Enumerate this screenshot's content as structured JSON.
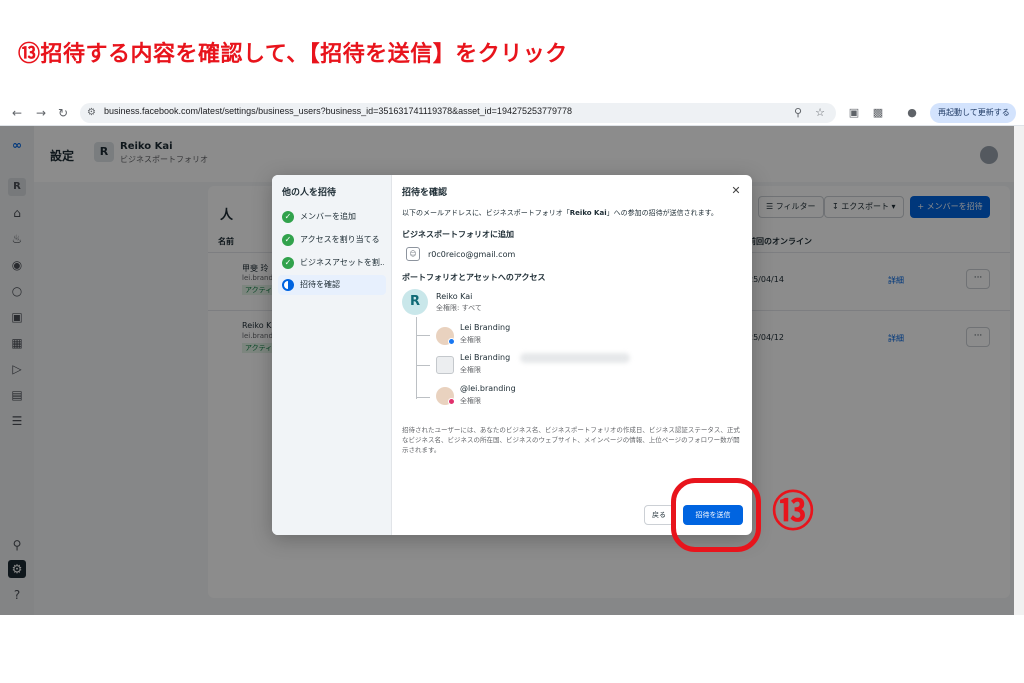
{
  "instruction": "⑬招待する内容を確認して、【招待を送信】をクリック",
  "browser": {
    "url": "business.facebook.com/latest/settings/business_users?business_id=351631741119378&asset_id=194275253779778",
    "relaunch_label": "再起動して更新する",
    "icons": {
      "back": "arrow-left-icon",
      "forward": "arrow-right-icon",
      "reload": "reload-icon"
    }
  },
  "app": {
    "settings_title": "設定",
    "business_avatar": "R",
    "business_name": "Reiko Kai",
    "business_type": "ビジネスポートフォリオ",
    "nav_avatar": "R",
    "people": {
      "title": "人",
      "filter_label": "フィルター",
      "export_label": "エクスポート",
      "invite_label": "メンバーを招待",
      "col_name": "名前",
      "col_online": "前回のオンライン",
      "rows": [
        {
          "name": "甲斐 玲",
          "sub": "lei.brand",
          "badge": "アクティブ",
          "date": "25/04/14",
          "detail": "詳細",
          "more": "···"
        },
        {
          "name": "Reiko K",
          "sub": "lei.brand",
          "badge": "アクティブ",
          "date": "25/04/12",
          "detail": "詳細",
          "more": "···"
        }
      ]
    }
  },
  "modal": {
    "steps_title": "他の人を招待",
    "steps": [
      {
        "label": "メンバーを追加",
        "state": "done"
      },
      {
        "label": "アクセスを割り当てる",
        "state": "done"
      },
      {
        "label": "ビジネスアセットを割…",
        "state": "done"
      },
      {
        "label": "招待を確認",
        "state": "current"
      }
    ],
    "title": "招待を確認",
    "description_prefix": "以下のメールアドレスに、ビジネスポートフォリオ「",
    "description_bold": "Reiko Kai",
    "description_suffix": "」への参加の招待が送信されます。",
    "section_add": "ビジネスポートフォリオに追加",
    "email": "r0c0reico@gmail.com",
    "section_access": "ポートフォリオとアセットへのアクセス",
    "owner": {
      "avatar": "R",
      "name": "Reiko Kai",
      "permission": "全権限: すべて"
    },
    "assets": [
      {
        "name": "Lei Branding",
        "permission": "全権限",
        "kind": "facebook-page",
        "badge_color": "#1877f2"
      },
      {
        "name": "Lei Branding",
        "permission": "全権限",
        "kind": "ad-account",
        "badge_color": ""
      },
      {
        "name": "@lei.branding",
        "permission": "全権限",
        "kind": "instagram",
        "badge_color": "#e1306c"
      }
    ],
    "disclaimer": "招待されたユーザーには、あなたのビジネス名、ビジネスポートフォリオの作成日、ビジネス認証ステータス、正式なビジネス名、ビジネスの所在国、ビジネスのウェブサイト、メインページの情報、上位ページのフォロワー数が開示されます。",
    "back_label": "戻る",
    "send_label": "招待を送信"
  },
  "annotation": {
    "step_number": "⑬",
    "color": "#e8141c"
  }
}
